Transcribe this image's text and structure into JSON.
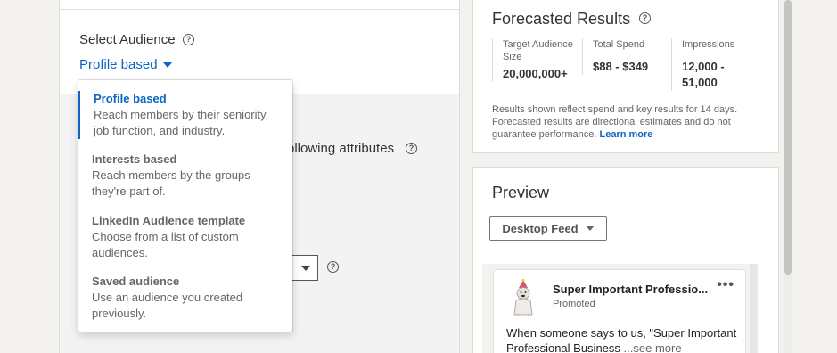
{
  "audience": {
    "label": "Select Audience",
    "selected": "Profile based",
    "options": [
      {
        "title": "Profile based",
        "description": "Reach members by their seniority, job function, and industry."
      },
      {
        "title": "Interests based",
        "description": "Reach members by the groups they're part of."
      },
      {
        "title": "LinkedIn Audience template",
        "description": "Choose from a list of custom audiences."
      },
      {
        "title": "Saved audience",
        "description": "Use an audience you created previously."
      }
    ]
  },
  "targeting": {
    "attributes_text": "ollowing attributes",
    "add_link": "+ Job Seniorities"
  },
  "forecast": {
    "title": "Forecasted Results",
    "metrics": [
      {
        "label": "Target Audience Size",
        "value": "20,000,000+"
      },
      {
        "label": "Total Spend",
        "value": "$88 - $349"
      },
      {
        "label": "Impressions",
        "value": "12,000 - 51,000"
      }
    ],
    "note": "Results shown reflect spend and key results for 14 days. Forecasted results are directional estimates and do not guarantee performance.",
    "learn_more": "Learn more"
  },
  "preview": {
    "title": "Preview",
    "feed_selector": "Desktop Feed",
    "post": {
      "company": "Super Important Professio...",
      "promoted": "Promoted",
      "more": "•••",
      "text": "When someone says to us, \"Super Important Professional Business",
      "see_more": "...see more"
    }
  }
}
